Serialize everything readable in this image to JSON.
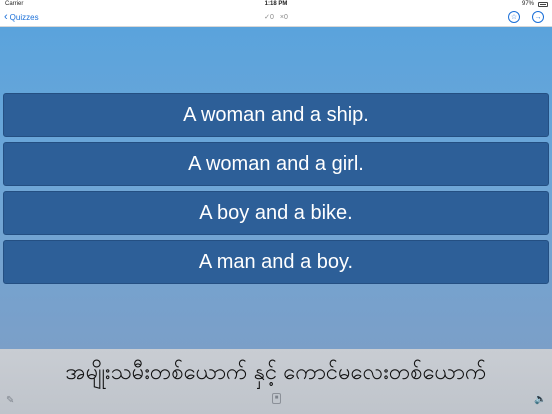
{
  "status_bar": {
    "carrier": "Carrier",
    "time": "1:18 PM",
    "battery": "97%"
  },
  "nav": {
    "back_label": "Quizzes",
    "correct_count": "✓0",
    "wrong_count": "×0",
    "icons": {
      "favorite": "star-icon",
      "next": "arrow-right-icon"
    }
  },
  "answers": [
    "A woman and a ship.",
    "A woman and a girl.",
    "A boy and a bike.",
    "A man and a boy."
  ],
  "question": {
    "text": "အမျိုးသမီးတစ်ယောက် နှင့် ကောင်မလေးတစ်ယောက်"
  },
  "toolbar_icons": {
    "left": "pencil-icon",
    "center": "hint-icon",
    "right": "speaker-icon"
  },
  "colors": {
    "accent": "#1a6fd8",
    "answer_bg": "#2d5f98"
  }
}
